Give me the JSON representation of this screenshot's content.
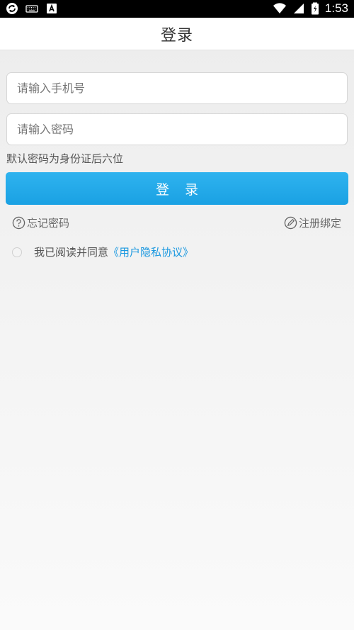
{
  "status_bar": {
    "time": "1:53",
    "left_icons": [
      "sync-icon",
      "keyboard-icon",
      "a-notification-icon"
    ],
    "right_icons": [
      "wifi-icon",
      "signal-icon",
      "battery-icon"
    ]
  },
  "header": {
    "title": "登录"
  },
  "form": {
    "phone_placeholder": "请输入手机号",
    "password_placeholder": "请输入密码",
    "hint": "默认密码为身份证后六位",
    "login_label": "登录"
  },
  "links": {
    "forgot": "忘记密码",
    "register": "注册绑定"
  },
  "agreement": {
    "text": "我已阅读并同意",
    "link": "《用户隐私协议》"
  },
  "colors": {
    "accent": "#1aa1e3",
    "link": "#1a98e0"
  }
}
